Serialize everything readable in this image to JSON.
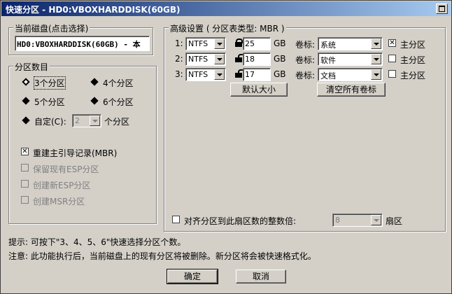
{
  "window": {
    "title": "快速分区 - HD0:VBOXHARDDISK(60GB)"
  },
  "current_disk": {
    "label": "当前磁盘(点击选择)",
    "value": "HD0:VBOXHARDDISK(60GB) - 本"
  },
  "partition_count": {
    "label": "分区数目",
    "options": [
      "3个分区",
      "4个分区",
      "5个分区",
      "6个分区"
    ],
    "selected": "3个分区",
    "custom_label": "自定(C):",
    "custom_value": "2",
    "custom_suffix": "个分区"
  },
  "options": [
    {
      "label": "重建主引导记录(MBR)",
      "checked": true,
      "enabled": true
    },
    {
      "label": "保留现有ESP分区",
      "checked": false,
      "enabled": false
    },
    {
      "label": "创建新ESP分区",
      "checked": false,
      "enabled": false
    },
    {
      "label": "创建MSR分区",
      "checked": false,
      "enabled": false
    }
  ],
  "advanced": {
    "label": "高级设置 ( 分区表类型: MBR )",
    "size_unit": "GB",
    "volume_label_text": "卷标:",
    "primary_text": "主分区",
    "rows": [
      {
        "index": "1:",
        "fs": "NTFS",
        "lock": "locked",
        "size": "25",
        "label": "系统",
        "primary": true
      },
      {
        "index": "2:",
        "fs": "NTFS",
        "lock": "unlocked",
        "size": "18",
        "label": "软件",
        "primary": false
      },
      {
        "index": "3:",
        "fs": "NTFS",
        "lock": "unlocked",
        "size": "17",
        "label": "文档",
        "primary": false
      }
    ],
    "default_size_button": "默认大小",
    "clear_labels_button": "清空所有卷标",
    "align_label": "对齐分区到此扇区数的整数倍:",
    "align_value": "8",
    "align_unit": "扇区"
  },
  "notes": {
    "hint": "提示: 可按下\"3、4、5、6\"快速选择分区个数。",
    "warning": "注意: 此功能执行后，当前磁盘上的现有分区将被删除。新分区将会被快速格式化。"
  },
  "buttons": {
    "ok": "确定",
    "cancel": "取消"
  }
}
